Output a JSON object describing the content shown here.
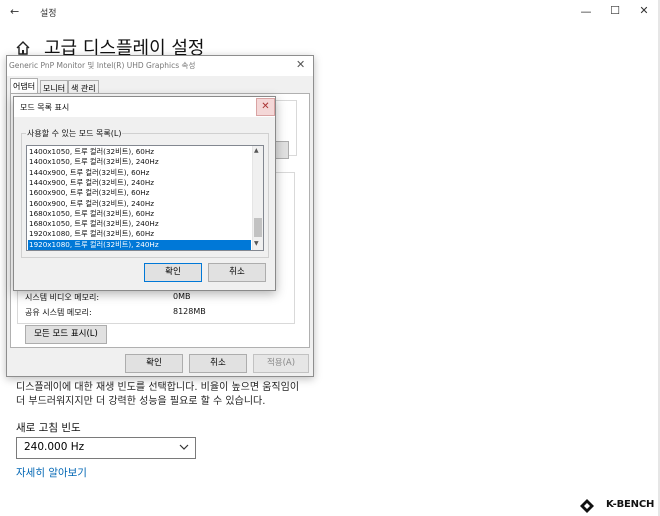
{
  "window": {
    "title": "설정",
    "controls": {
      "minimize": "—",
      "maximize": "☐",
      "close": "✕"
    },
    "back": "←"
  },
  "page": {
    "title": "고급 디스플레이 설정",
    "refresh_desc": "디스플레이에 대한 재생 빈도를 선택합니다. 비율이 높으면 움직임이 더 부드러워지지만 더 강력한 성능을 필요로 할 수 있습니다.",
    "refresh_label": "새로 고침 빈도",
    "refresh_value": "240.000 Hz",
    "learn_more": "자세히 알아보기"
  },
  "props_dialog": {
    "title": "Generic PnP Monitor 및 Intel(R) UHD Graphics 속성",
    "tabs": [
      "어댑터",
      "모니터",
      "색 관리"
    ],
    "rows": [
      {
        "label": "시스템 비디오 메모리:",
        "value": "0MB"
      },
      {
        "label": "공유 시스템 메모리:",
        "value": "8128MB"
      }
    ],
    "list_all_modes": "모든 모드 표시(L)",
    "ok": "확인",
    "cancel": "취소",
    "apply": "적용(A)"
  },
  "modes_dialog": {
    "title": "모드 목록 표시",
    "group_label": "사용할 수 있는 모드 목록(L)",
    "modes": [
      "1400x1050, 트루 컬러(32비트), 60Hz",
      "1400x1050, 트루 컬러(32비트), 240Hz",
      "1440x900, 트루 컬러(32비트), 60Hz",
      "1440x900, 트루 컬러(32비트), 240Hz",
      "1600x900, 트루 컬러(32비트), 60Hz",
      "1600x900, 트루 컬러(32비트), 240Hz",
      "1680x1050, 트루 컬러(32비트), 60Hz",
      "1680x1050, 트루 컬러(32비트), 240Hz",
      "1920x1080, 트루 컬러(32비트), 60Hz",
      "1920x1080, 트루 컬러(32비트), 240Hz"
    ],
    "selected_index": 9,
    "ok": "확인",
    "cancel": "취소"
  },
  "logo": {
    "text": "K-BENCH"
  },
  "colors": {
    "accent": "#0078d7",
    "link": "#0066b4"
  }
}
